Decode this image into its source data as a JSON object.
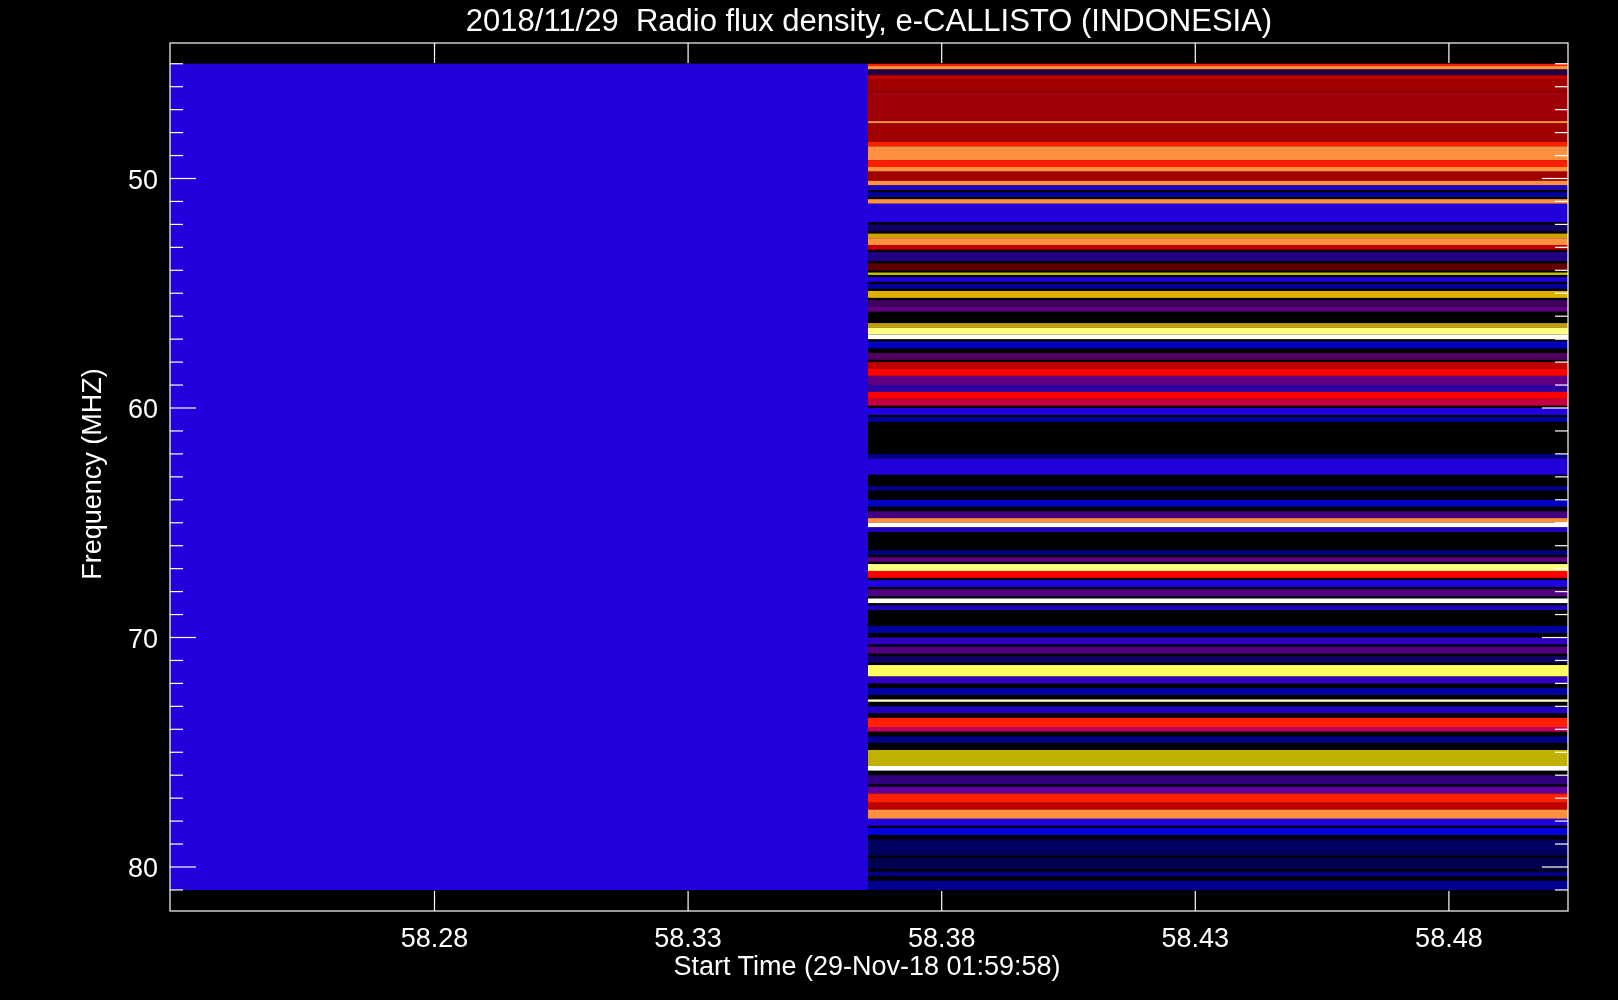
{
  "title": "2018/11/29  Radio flux density, e-CALLISTO (INDONESIA)",
  "y_axis": {
    "label": "Frequency (MHZ)",
    "tick_labels": [
      "50",
      "60",
      "70",
      "80"
    ]
  },
  "x_axis": {
    "label": "Start Time (29-Nov-18 01:59:58)",
    "tick_labels": [
      "58.28",
      "58.33",
      "58.38",
      "58.43",
      "58.48"
    ]
  }
}
